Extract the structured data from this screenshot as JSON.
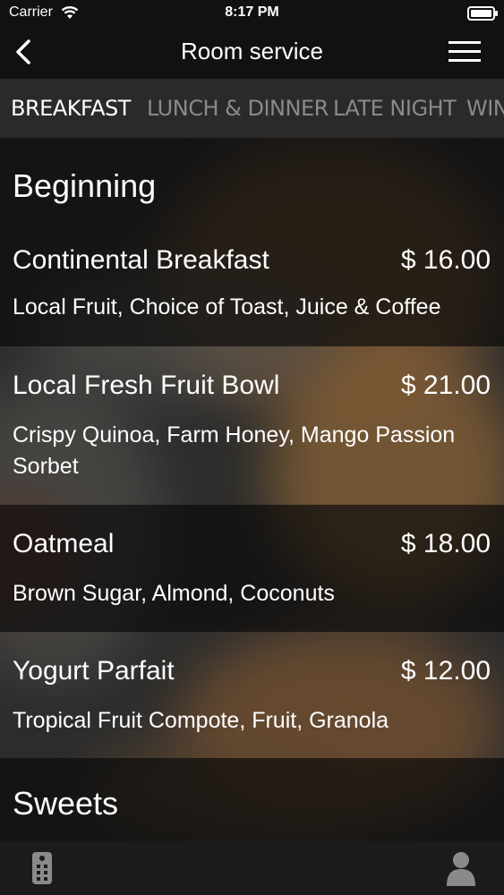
{
  "status_bar": {
    "carrier": "Carrier",
    "time": "8:17 PM"
  },
  "nav": {
    "title": "Room service"
  },
  "tabs": [
    {
      "label": "BREAKFAST"
    },
    {
      "label": "LUNCH & DINNER"
    },
    {
      "label": "LATE NIGHT"
    },
    {
      "label": "WIN"
    }
  ],
  "sections": [
    {
      "title": "Beginning",
      "items": [
        {
          "name": "Continental Breakfast",
          "price": "$ 16.00",
          "description": "Local Fruit, Choice of Toast, Juice & Coffee"
        },
        {
          "name": "Local Fresh Fruit Bowl",
          "price": "$ 21.00",
          "description": "Crispy Quinoa, Farm Honey, Mango Passion Sorbet"
        },
        {
          "name": "Oatmeal",
          "price": "$ 18.00",
          "description": "Brown Sugar, Almond, Coconuts"
        },
        {
          "name": "Yogurt Parfait",
          "price": "$ 12.00",
          "description": "Tropical Fruit Compote, Fruit, Granola"
        }
      ]
    },
    {
      "title": "Sweets"
    }
  ],
  "icons": {
    "back": "chevron-left-icon",
    "menu": "hamburger-menu-icon",
    "remote": "remote-control-icon",
    "profile": "person-icon"
  },
  "colors": {
    "active_tab": "#ffffff",
    "inactive_tab": "#8a8a8a",
    "bar_background": "#111111"
  }
}
